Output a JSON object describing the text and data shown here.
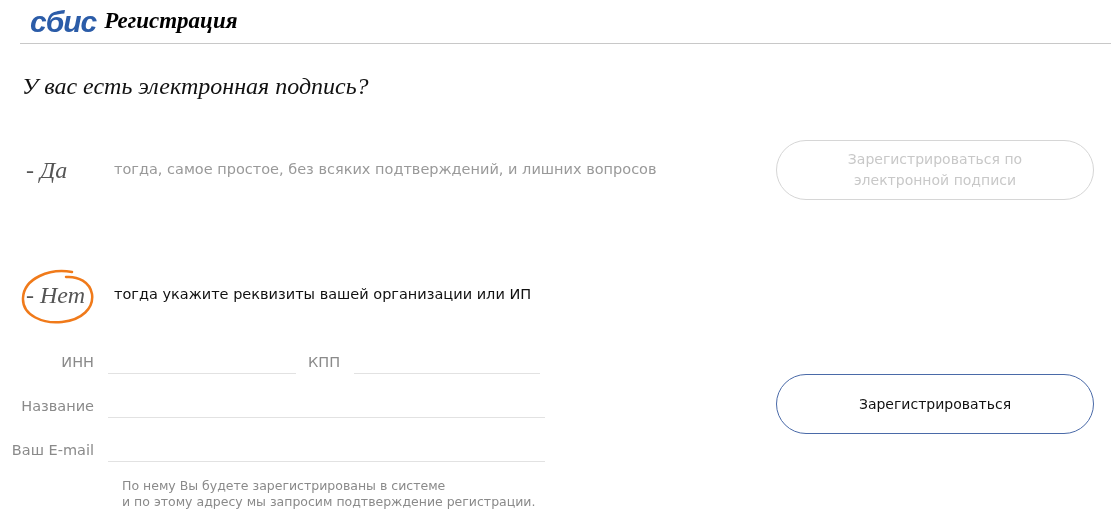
{
  "header": {
    "logo": "сбис",
    "title": "Регистрация"
  },
  "question": "У вас есть электронная подпись?",
  "options": [
    {
      "label": "- Да",
      "description": "тогда, самое простое, без всяких подтверждений, и лишних вопросов",
      "selected": false
    },
    {
      "label": "- Нет",
      "description": "тогда укажите реквизиты вашей организации или ИП",
      "selected": true
    }
  ],
  "signature_button": {
    "label": "Зарегистрироваться по электронной подписи",
    "disabled": true
  },
  "field_rows": [
    [
      {
        "label": "ИНН"
      },
      {
        "label": "КПП"
      }
    ],
    [
      {
        "label": "Название"
      }
    ],
    [
      {
        "label": "Ваш E-mail"
      }
    ]
  ],
  "note": [
    "По нему Вы будете зарегистрированы в системе",
    "и по этому адресу мы запросим подтверждение регистрации."
  ],
  "register_button": {
    "label": "Зарегистрироваться",
    "disabled": false
  }
}
